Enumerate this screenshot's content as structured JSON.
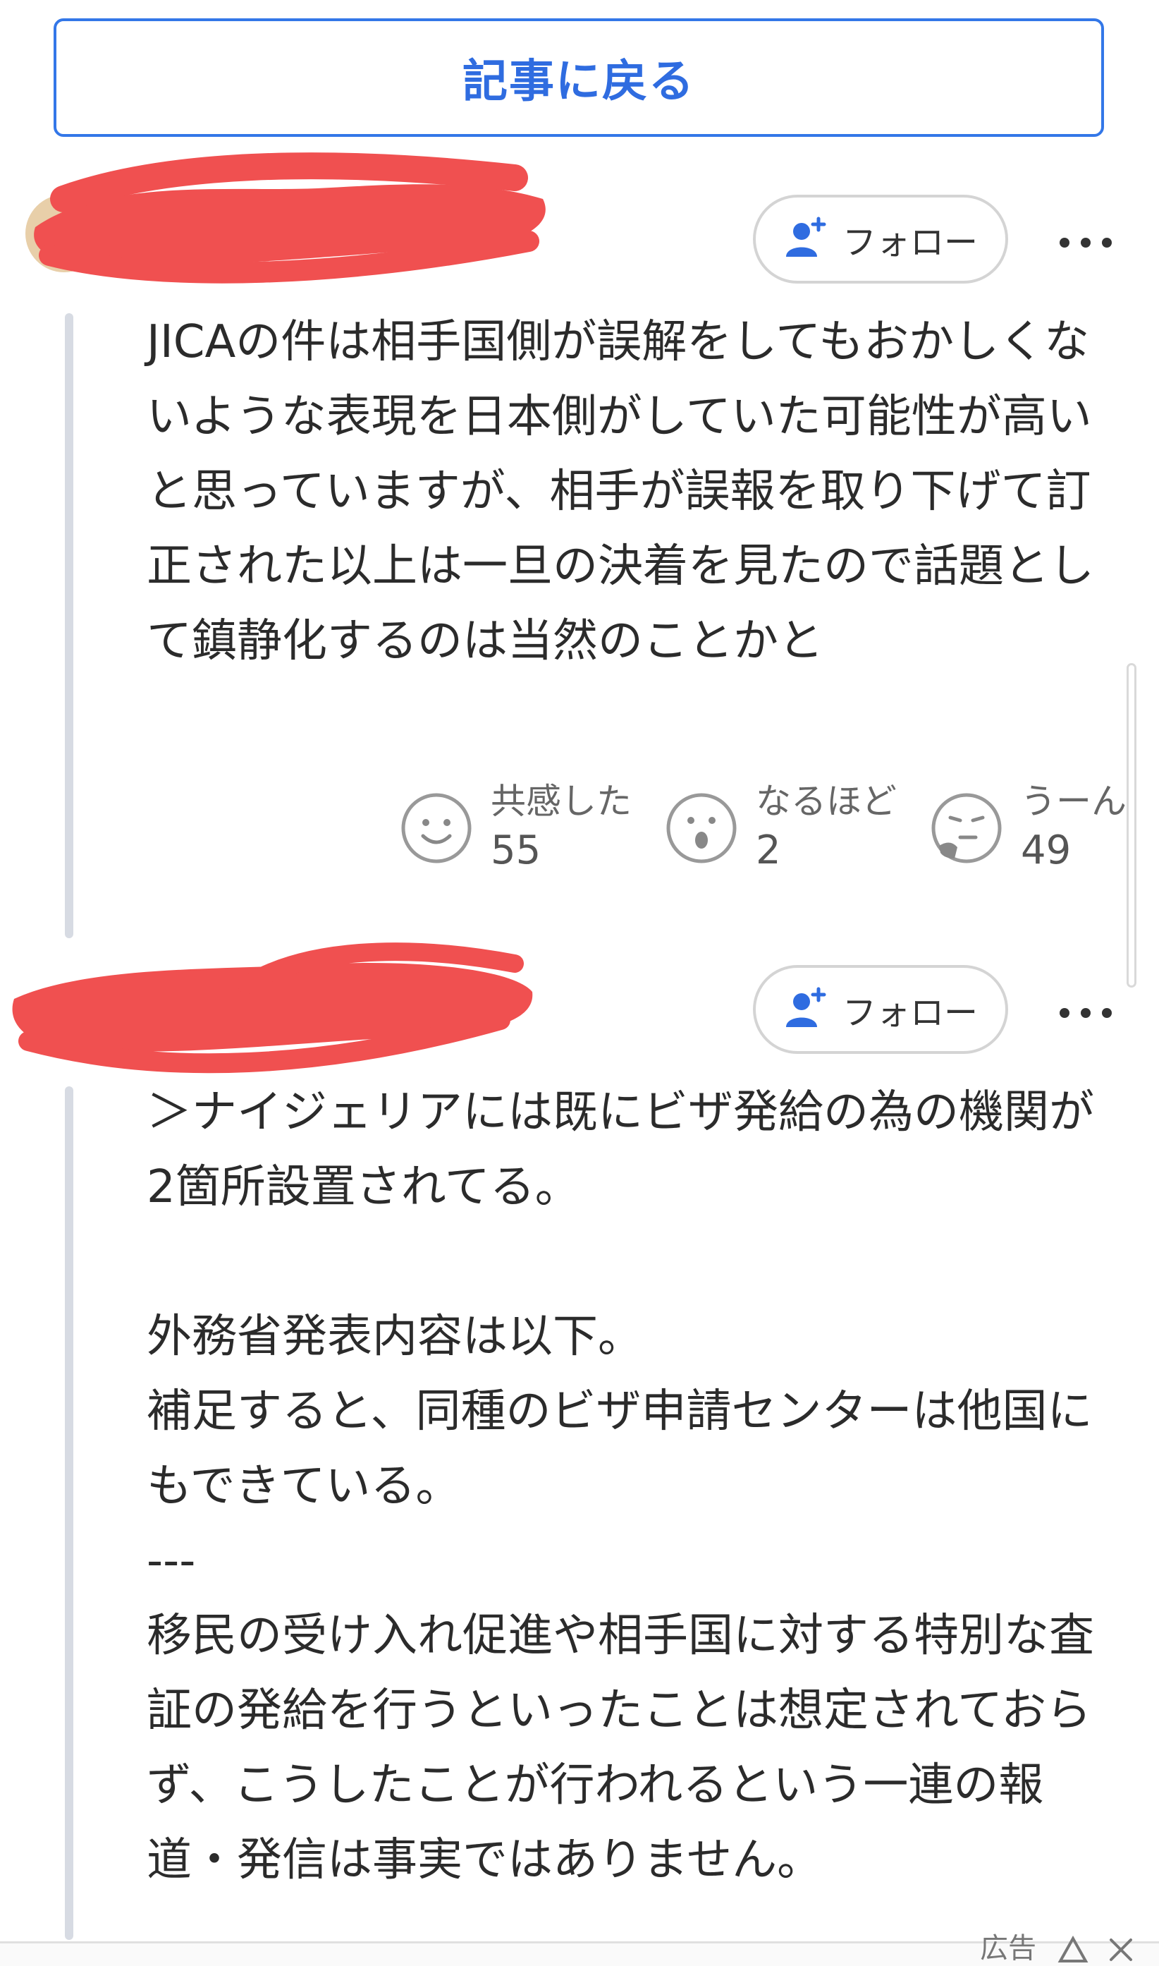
{
  "back_button": {
    "label": "記事に戻る"
  },
  "comments": [
    {
      "follow_label": "フォロー",
      "text": "JICAの件は相手国側が誤解をしてもおかしくないような表現を日本側がしていた可能性が高いと思っていますが、相手が誤報を取り下げて訂正された以上は一旦の決着を見たので話題として鎮静化するのは当然のことかと",
      "reactions": [
        {
          "label": "共感した",
          "count": "55",
          "icon": "smile-icon"
        },
        {
          "label": "なるほど",
          "count": "2",
          "icon": "surprised-icon"
        },
        {
          "label": "うーん",
          "count": "49",
          "icon": "thinking-icon"
        }
      ]
    },
    {
      "follow_label": "フォロー",
      "text": "＞ナイジェリアには既にビザ発給の為の機関が2箇所設置されてる。\n\n外務省発表内容は以下。\n補足すると、同種のビザ申請センターは他国にもできている。\n---\n移民の受け入れ促進や相手国に対する特別な査証の発給を行うといったことは想定されておらず、こうしたことが行われるという一連の報道・発信は事実ではありません。"
    }
  ],
  "ad": {
    "label": "広告"
  },
  "colors": {
    "accent": "#2f6ce0",
    "redaction": "#f05050",
    "thread_line": "#d7dbe3"
  }
}
